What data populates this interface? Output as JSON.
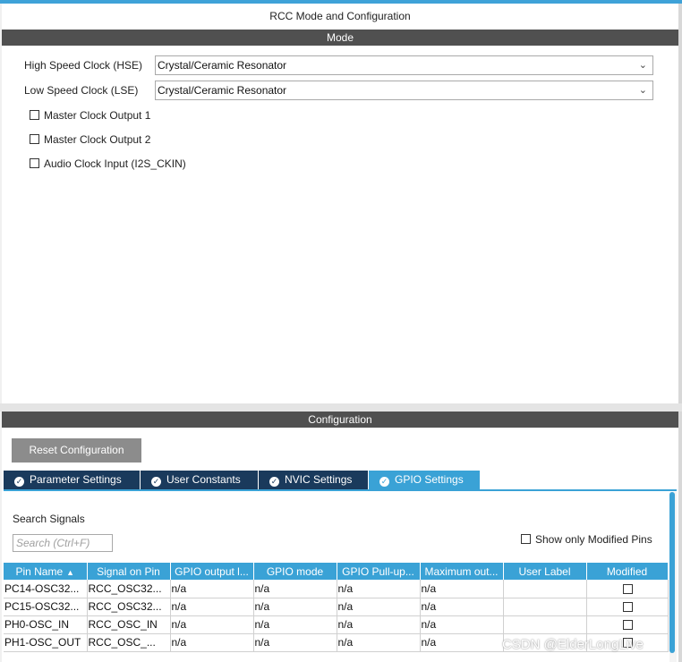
{
  "panel_title": "RCC Mode and Configuration",
  "mode": {
    "header": "Mode",
    "hse_label": "High Speed Clock (HSE)",
    "hse_value": "Crystal/Ceramic Resonator",
    "lse_label": "Low Speed Clock (LSE)",
    "lse_value": "Crystal/Ceramic Resonator",
    "checkboxes": [
      {
        "label": "Master Clock Output 1",
        "checked": false
      },
      {
        "label": "Master Clock Output 2",
        "checked": false
      },
      {
        "label": "Audio Clock Input (I2S_CKIN)",
        "checked": false
      }
    ]
  },
  "configuration": {
    "header": "Configuration",
    "reset_label": "Reset Configuration",
    "tabs": [
      {
        "label": "Parameter Settings",
        "active": false
      },
      {
        "label": "User Constants",
        "active": false
      },
      {
        "label": "NVIC Settings",
        "active": false
      },
      {
        "label": "GPIO Settings",
        "active": true
      }
    ],
    "search_label": "Search Signals",
    "search_placeholder": "Search (Ctrl+F)",
    "show_modified_label": "Show only Modified Pins",
    "table": {
      "columns": [
        "Pin Name",
        "Signal on Pin",
        "GPIO output l...",
        "GPIO mode",
        "GPIO Pull-up...",
        "Maximum out...",
        "User Label",
        "Modified"
      ],
      "rows": [
        [
          "PC14-OSC32...",
          "RCC_OSC32...",
          "n/a",
          "n/a",
          "n/a",
          "n/a",
          "",
          false
        ],
        [
          "PC15-OSC32...",
          "RCC_OSC32...",
          "n/a",
          "n/a",
          "n/a",
          "n/a",
          "",
          false
        ],
        [
          "PH0-OSC_IN",
          "RCC_OSC_IN",
          "n/a",
          "n/a",
          "n/a",
          "n/a",
          "",
          false
        ],
        [
          "PH1-OSC_OUT",
          "RCC_OSC_...",
          "n/a",
          "n/a",
          "n/a",
          "n/a",
          "",
          false
        ]
      ]
    }
  },
  "watermark": "CSDN @ElderLongLive",
  "colors": {
    "accent": "#3aa2d6",
    "tab_dark": "#1a3a5c",
    "section_header": "#505050"
  }
}
